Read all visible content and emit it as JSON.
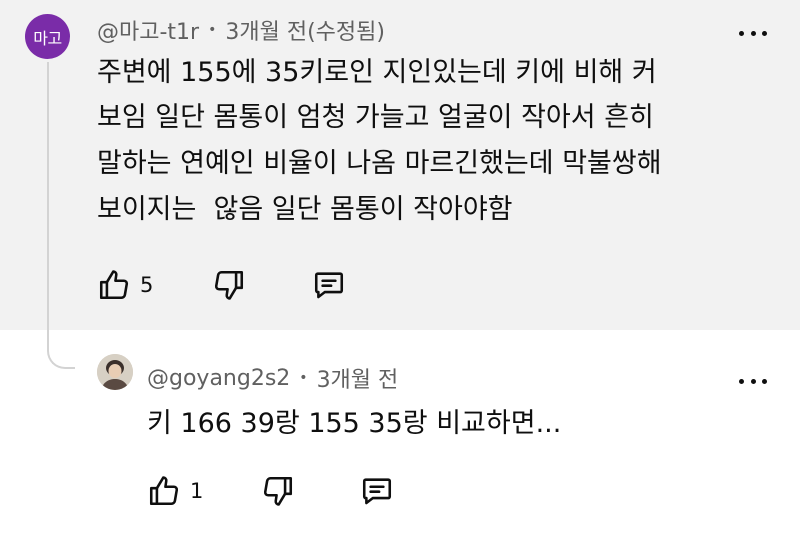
{
  "parent_comment": {
    "avatar_text": "마고",
    "handle": "@마고-t1r",
    "time": "3개월 전(수정됨)",
    "body_lines": [
      "주변에 155에 35키로인 지인있는데 키에 비해 커",
      "보임 일단 몸통이 엄청 가늘고 얼굴이 작아서 흔히",
      "말하는 연예인 비율이 나옴 마르긴했는데 막불쌍해",
      "보이지는  않음 일단 몸통이 작아야함"
    ],
    "like_count": "5",
    "icons": [
      "thumbs-up-icon",
      "thumbs-down-icon",
      "reply-icon",
      "more-vert-icon"
    ]
  },
  "reply_comment": {
    "handle": "@goyang2s2",
    "time": "3개월 전",
    "body": "키 166 39랑 155 35랑 비교하면...",
    "like_count": "1",
    "icons": [
      "thumbs-up-icon",
      "thumbs-down-icon",
      "reply-icon",
      "more-vert-icon"
    ]
  },
  "colors": {
    "parent_background": "#f2f2f2",
    "avatar_purple": "#7a2ca8",
    "meta_gray": "#606060",
    "thread_line": "#d3d3d3"
  }
}
